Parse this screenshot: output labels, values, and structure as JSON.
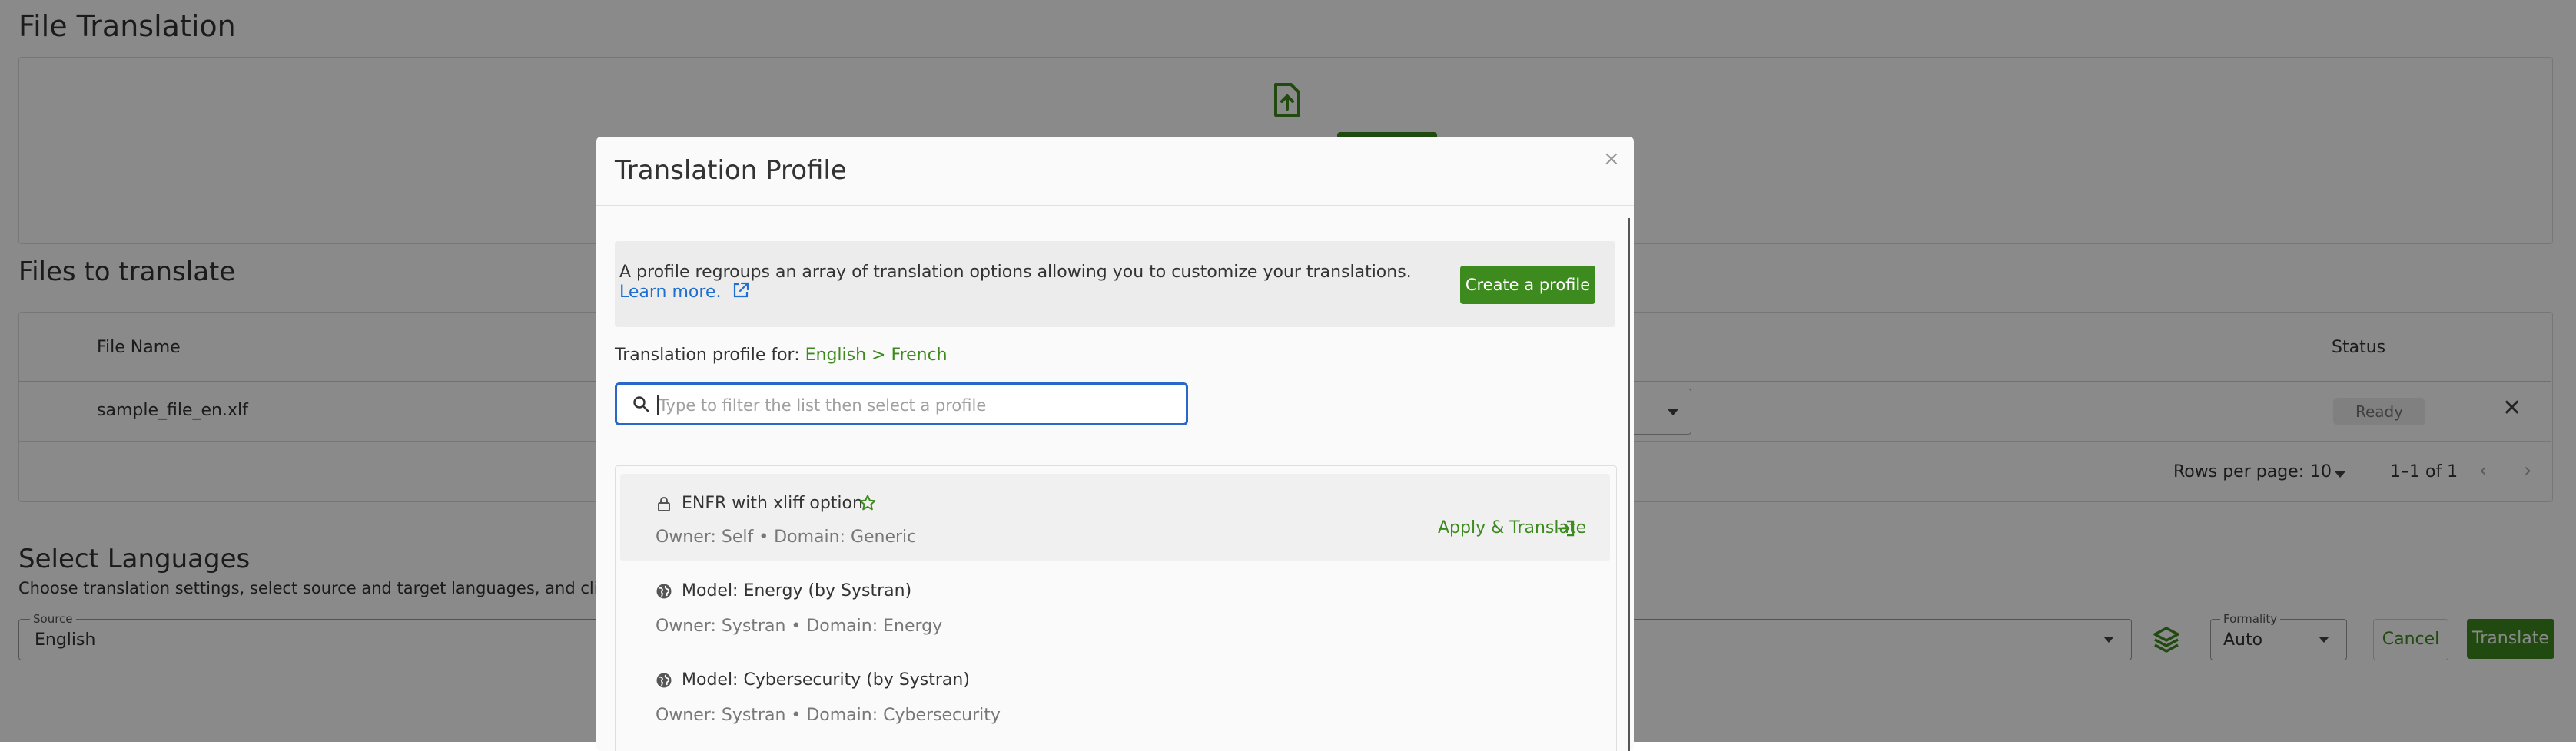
{
  "page": {
    "title": "File Translation",
    "files_section_title": "Files to translate",
    "table": {
      "headers": {
        "file_name": "File Name",
        "status": "Status"
      },
      "rows": [
        {
          "file_name": "sample_file_en.xlf",
          "status": "Ready"
        }
      ],
      "rows_per_page_label": "Rows per page:",
      "rows_per_page_value": "10",
      "range": "1–1 of 1"
    },
    "languages": {
      "title": "Select Languages",
      "subtitle": "Choose translation settings, select source and target languages, and click on '",
      "source_label": "Source",
      "source_value": "English",
      "formality_label": "Formality",
      "formality_value": "Auto",
      "cancel_label": "Cancel",
      "translate_label": "Translate"
    }
  },
  "modal": {
    "title": "Translation Profile",
    "close_glyph": "×",
    "info_text": "A profile regroups an array of translation options allowing you to customize your translations.",
    "learn_more": "Learn more.",
    "create_button": "Create a profile",
    "profile_for_label": "Translation profile for:",
    "profile_for_value": "English > French",
    "search": {
      "placeholder": "Type to filter the list then select a profile",
      "value": ""
    },
    "profiles": [
      {
        "name": "ENFR with xliff option",
        "meta": "Owner: Self • Domain: Generic",
        "icon": "lock-icon",
        "favorite": true,
        "action": "Apply & Translate"
      },
      {
        "name": "Model: Energy (by Systran)",
        "meta": "Owner: Systran • Domain: Energy",
        "icon": "globe-icon"
      },
      {
        "name": "Model: Cybersecurity (by Systran)",
        "meta": "Owner: Systran • Domain: Cybersecurity",
        "icon": "globe-icon"
      }
    ]
  },
  "colors": {
    "accent": "#3d8a1f",
    "link": "#1e6fd0",
    "focus": "#2a67c8"
  }
}
